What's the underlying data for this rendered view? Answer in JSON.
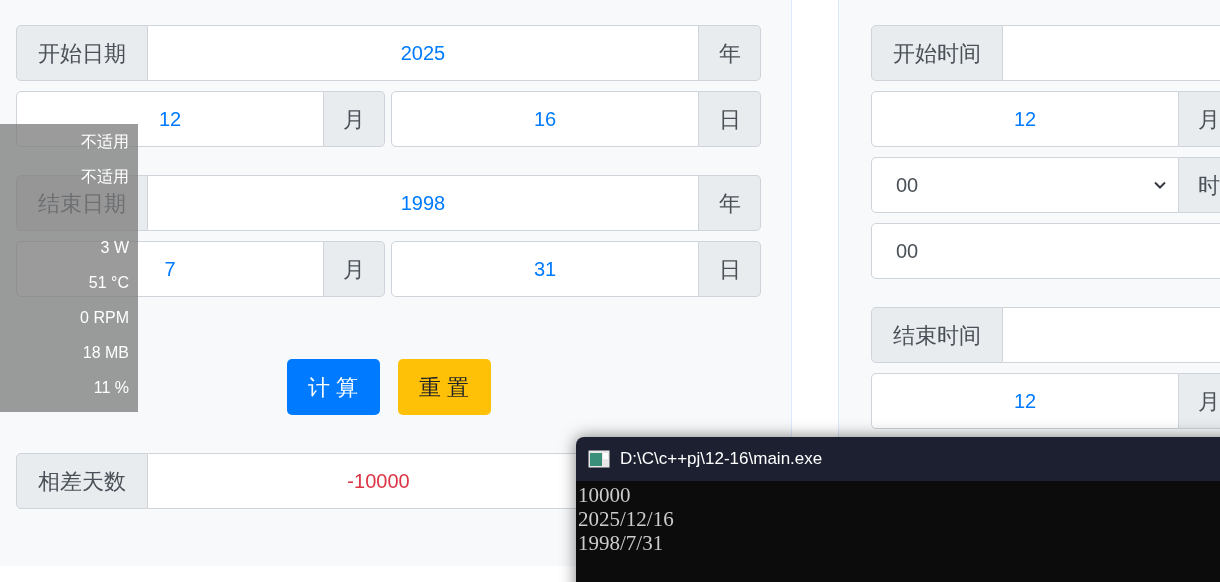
{
  "left_panel": {
    "start_date": {
      "label": "开始日期",
      "year": "2025",
      "year_unit": "年",
      "month": "12",
      "month_unit": "月",
      "day": "16",
      "day_unit": "日"
    },
    "end_date": {
      "label": "结束日期",
      "year": "1998",
      "year_unit": "年",
      "month": "7",
      "month_unit": "月",
      "day": "31",
      "day_unit": "日"
    },
    "buttons": [
      {
        "label": "计 算",
        "kind": "primary"
      },
      {
        "label": "重 置",
        "kind": "warning"
      }
    ],
    "result": {
      "label": "相差天数",
      "value": "-10000"
    }
  },
  "right_panel": {
    "start_time": {
      "label": "开始时间",
      "month": "12",
      "month_unit": "月",
      "hour": "00",
      "hour_unit": "时",
      "minute": "00"
    },
    "end_time": {
      "label": "结束时间",
      "month": "12",
      "month_unit": "月"
    }
  },
  "overlay": {
    "readings": [
      "不适用",
      "不适用",
      "3 W",
      "51 °C",
      "0 RPM",
      "18 MB",
      "11 %"
    ]
  },
  "console": {
    "title": "D:\\C\\c++pj\\12-16\\main.exe",
    "lines": [
      "10000",
      "2025/12/16",
      "1998/7/31"
    ]
  }
}
